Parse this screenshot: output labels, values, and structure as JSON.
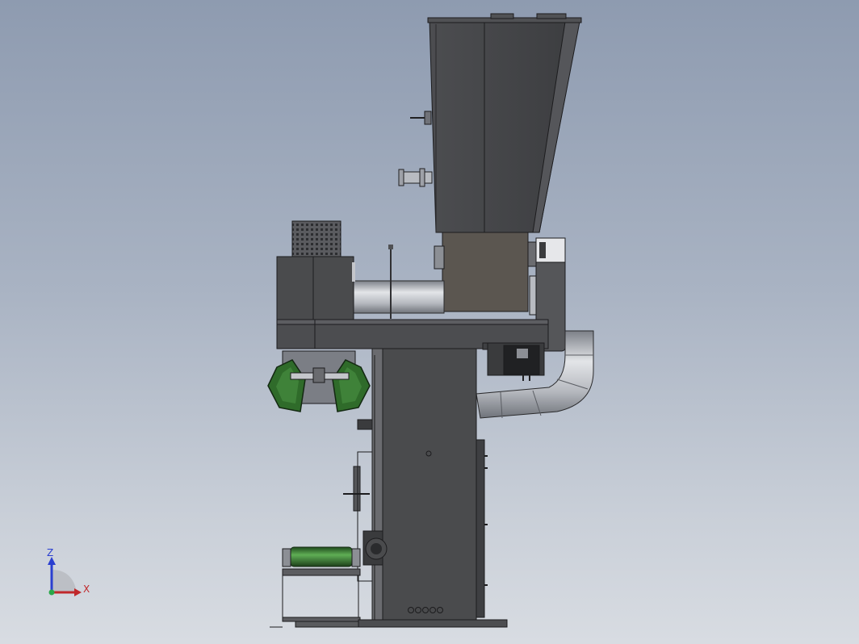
{
  "viewport": {
    "background_top": "#8e9bb0",
    "background_bottom": "#d8dce2"
  },
  "triad": {
    "z_label": "Z",
    "x_label": "X",
    "z_color": "#2a3fd0",
    "x_color": "#c0282b",
    "y_color": "#2aa84a"
  },
  "model": {
    "body_color": "#4a4b4d",
    "body_dark": "#3a3b3d",
    "body_light": "#5a5b5e",
    "metal_light": "#c4c6cb",
    "metal_mid": "#9ea1a8",
    "green": "#2f6b2a",
    "green_light": "#4f9a47",
    "brown": "#5b5650"
  }
}
